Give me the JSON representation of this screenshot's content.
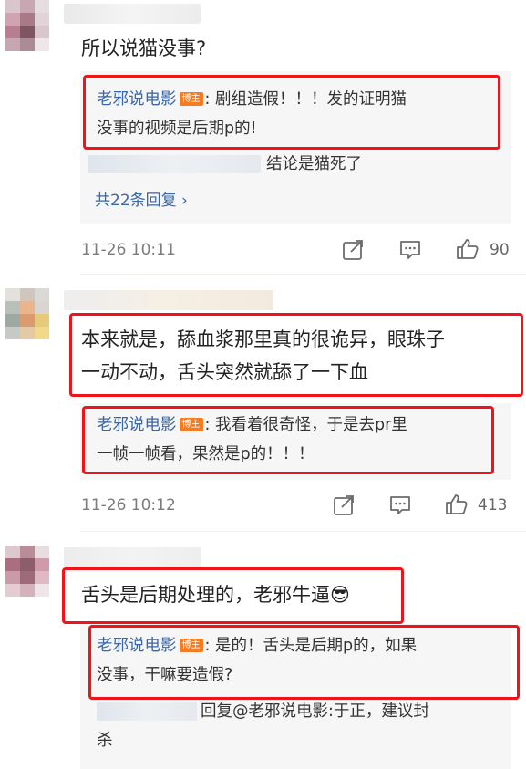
{
  "comments": [
    {
      "text_lines": [
        "所以说猫没事?"
      ],
      "author_reply": {
        "name": "老邪说电影",
        "badge": "博主",
        "lines": [
          ": 剧组造假！！！发的证明猫",
          "没事的视频是后期p的!"
        ]
      },
      "sub_reply_text": "结论是猫死了",
      "more_replies": "共22条回复 ›",
      "time": "11-26 10:11",
      "likes": "90"
    },
    {
      "text_lines": [
        "本来就是，舔血浆那里真的很诡异，眼珠子",
        "一动不动，舌头突然就舔了一下血"
      ],
      "author_reply": {
        "name": "老邪说电影",
        "badge": "博主",
        "lines": [
          ": 我看着很奇怪，于是去pr里",
          "一帧一帧看，果然是p的！！！"
        ]
      },
      "time": "11-26 10:12",
      "likes": "413"
    },
    {
      "text_lines": [
        "舌头是后期处理的，老邪牛逼😎"
      ],
      "author_reply": {
        "name": "老邪说电影",
        "badge": "博主",
        "lines": [
          ": 是的！舌头是后期p的，如果",
          "没事，干嘛要造假?"
        ]
      },
      "sub_reply_lines": [
        "回复@老邪说电影:于正，建议封",
        "杀"
      ]
    }
  ],
  "colors": {
    "highlight_border": "#f0141a",
    "link_blue": "#3a67a8",
    "badge_orange": "#f47c22",
    "reply_bg": "#f6f6f6",
    "meta_gray": "#7b7b7b"
  },
  "icons": [
    "share-icon",
    "comment-icon",
    "like-icon"
  ]
}
